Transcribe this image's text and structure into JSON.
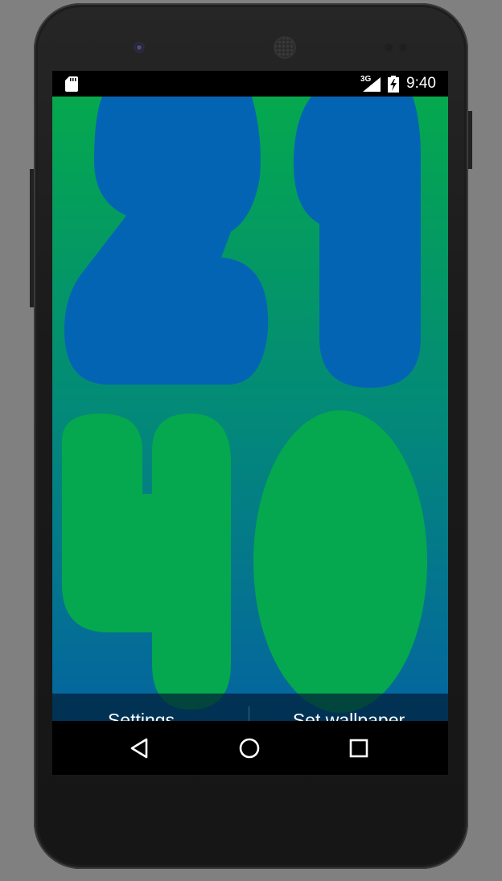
{
  "status_bar": {
    "network_type": "3G",
    "time": "9:40",
    "icons": [
      "sd-card-icon",
      "signal-icon",
      "battery-charging-icon"
    ]
  },
  "wallpaper": {
    "clock_digits": [
      "2",
      "1",
      "4",
      "0"
    ],
    "top_digit_color": "#0464b4",
    "bottom_digit_color": "#05a84e",
    "gradient_top": "#05a84e",
    "gradient_bottom": "#0464a0"
  },
  "actions": {
    "settings_label": "Settings…",
    "set_wallpaper_label": "Set wallpaper"
  },
  "nav_bar": {
    "buttons": [
      "back",
      "home",
      "recents"
    ]
  }
}
